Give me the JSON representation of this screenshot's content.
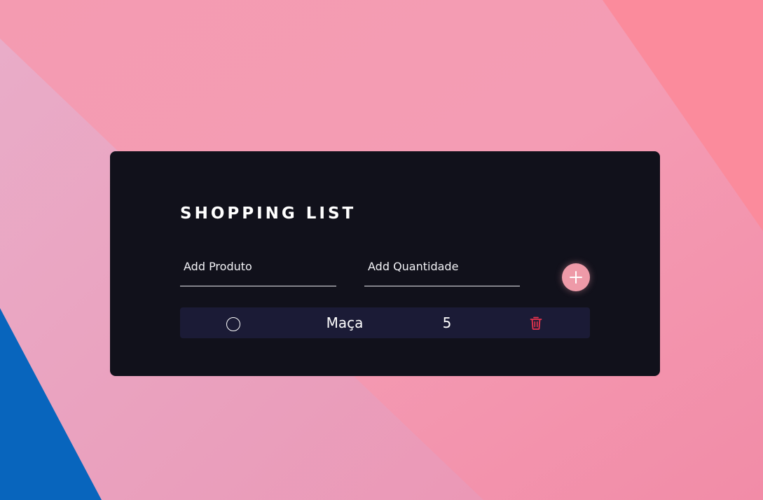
{
  "page": {
    "title": "SHOPPING LIST"
  },
  "form": {
    "product_placeholder": "Add Produto",
    "quantity_placeholder": "Add Quantidade",
    "product_value": "",
    "quantity_value": ""
  },
  "items": [
    {
      "name": "Maça",
      "quantity": "5",
      "checked": false
    }
  ],
  "icons": {
    "add": "plus-icon",
    "check": "circle-checkbox-icon",
    "delete": "trash-icon"
  },
  "colors": {
    "card_background": "#11111b",
    "item_background": "#1b1b36",
    "add_button": "#ee9aa8",
    "delete_icon": "#e8344e",
    "background_pink": "#f49ab3",
    "background_blue": "#0865bd"
  }
}
